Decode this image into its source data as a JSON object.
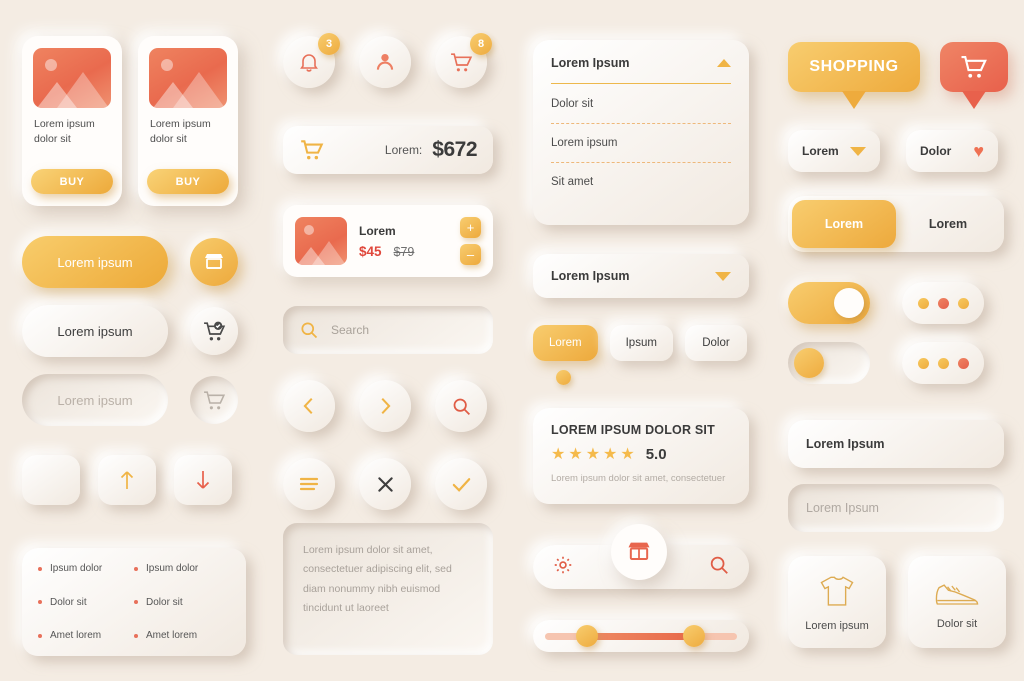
{
  "products": [
    {
      "title": "Lorem ipsum\ndolor sit",
      "button": "BUY"
    },
    {
      "title": "Lorem ipsum\ndolor sit",
      "button": "BUY"
    }
  ],
  "buttons": {
    "active_label": "Lorem ipsum",
    "normal_label": "Lorem ipsum",
    "disabled_label": "Lorem ipsum",
    "icons": [
      "store-icon",
      "cart-check-icon",
      "cart-icon"
    ]
  },
  "arrows": {
    "up": "arrow-up-icon",
    "down": "arrow-down-icon",
    "blank": "blank-icon"
  },
  "list_card": {
    "left": [
      "Ipsum dolor",
      "Dolor sit",
      "Amet lorem"
    ],
    "right": [
      "Ipsum dolor",
      "Dolor sit",
      "Amet lorem"
    ]
  },
  "top_icons": [
    {
      "name": "bell-icon",
      "badge": "3"
    },
    {
      "name": "user-icon",
      "badge": ""
    },
    {
      "name": "cart-icon",
      "badge": "8"
    }
  ],
  "total": {
    "label": "Lorem:",
    "value": "$672"
  },
  "cart_item": {
    "name": "Lorem",
    "price_new": "$45",
    "price_old": "$79",
    "plus": "+",
    "minus": "–"
  },
  "search": {
    "placeholder": "Search"
  },
  "nav_icons": [
    "chevron-left-icon",
    "chevron-right-icon",
    "search-icon",
    "menu-icon",
    "close-icon",
    "check-icon"
  ],
  "textarea": {
    "placeholder": "Lorem ipsum dolor sit amet, consectetuer adipiscing elit, sed diam nonummy nibh euismod tincidunt ut laoreet"
  },
  "accordion": {
    "header": "Lorem Ipsum",
    "items": [
      "Dolor sit",
      "Lorem ipsum",
      "Sit amet"
    ]
  },
  "select": {
    "value": "Lorem Ipsum"
  },
  "chips": [
    {
      "label": "Lorem",
      "active": true
    },
    {
      "label": "Ipsum",
      "active": false
    },
    {
      "label": "Dolor",
      "active": false
    }
  ],
  "review": {
    "title": "LOREM IPSUM DOLOR SIT",
    "score": "5.0",
    "stars": 5,
    "subtitle": "Lorem ipsum dolor sit amet, consectetuer"
  },
  "bottom_nav": {
    "left_icon": "gear-icon",
    "center_icon": "store-icon",
    "right_icon": "search-icon"
  },
  "slider": {
    "left_value": 22,
    "right_value": 77
  },
  "tooltips": {
    "shopping_label": "SHOPPING",
    "cart_icon": "cart-icon"
  },
  "dropdowns": [
    {
      "label": "Lorem",
      "icon": "triangle-down-icon"
    },
    {
      "label": "Dolor",
      "icon": "heart-icon"
    }
  ],
  "segment": [
    {
      "label": "Lorem",
      "active": true
    },
    {
      "label": "Lorem",
      "active": false
    }
  ],
  "fields": {
    "filled_value": "Lorem Ipsum",
    "empty_placeholder": "Lorem Ipsum"
  },
  "categories": [
    {
      "label": "Lorem ipsum",
      "icon": "tshirt-icon"
    },
    {
      "label": "Dolor sit",
      "icon": "sneaker-icon"
    }
  ],
  "colors": {
    "background": "#f4ece3",
    "amber": "#eeab3e",
    "amber_light": "#f8cd6f",
    "coral": "#e8604b",
    "coral_light": "#ef8566",
    "text": "#3b3b3b",
    "muted": "#b0a9a2"
  }
}
